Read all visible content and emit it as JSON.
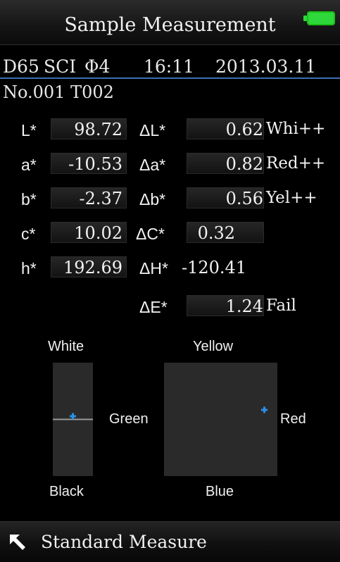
{
  "header": {
    "title": "Sample Measurement",
    "battery_icon": "battery-full-icon",
    "battery_color": "#2fd83a"
  },
  "info": {
    "illuminant": "D65",
    "mode": "SCI",
    "aperture": "Φ4",
    "time": "16:11",
    "date": "2013.03.11"
  },
  "sample_id": "No.001 T002",
  "rows": [
    {
      "label": "L*",
      "value": "98.72",
      "delta_label": "ΔL*",
      "delta_value": "0.62",
      "assessment": "Whi++"
    },
    {
      "label": "a*",
      "value": "-10.53",
      "delta_label": "Δa*",
      "delta_value": "0.82",
      "assessment": "Red++"
    },
    {
      "label": "b*",
      "value": "-2.37",
      "delta_label": "Δb*",
      "delta_value": "0.56",
      "assessment": "Yel++"
    },
    {
      "label": "c*",
      "value": "10.02",
      "delta_label": "ΔC*",
      "delta_value": "0.32",
      "assessment": ""
    },
    {
      "label": "h*",
      "value": "192.69",
      "delta_label": "ΔH*",
      "delta_value": "-120.41",
      "assessment": ""
    }
  ],
  "delta_e": {
    "label": "ΔE*",
    "value": "1.24",
    "result": "Fail"
  },
  "lightness_graph": {
    "top_label": "White",
    "bottom_label": "Black",
    "marker_color": "#2a8fe8"
  },
  "color_graph": {
    "top_label": "Yellow",
    "bottom_label": "Blue",
    "left_label": "Green",
    "right_label": "Red",
    "axis_colors": {
      "yellow": "#d9801a",
      "blue": "#1e3c9a",
      "green": "#2c8a2c",
      "red": "#d0242c"
    },
    "marker_color": "#2a8fe8"
  },
  "footer": {
    "label": "Standard Measure",
    "icon": "arrow-up-left-icon"
  }
}
